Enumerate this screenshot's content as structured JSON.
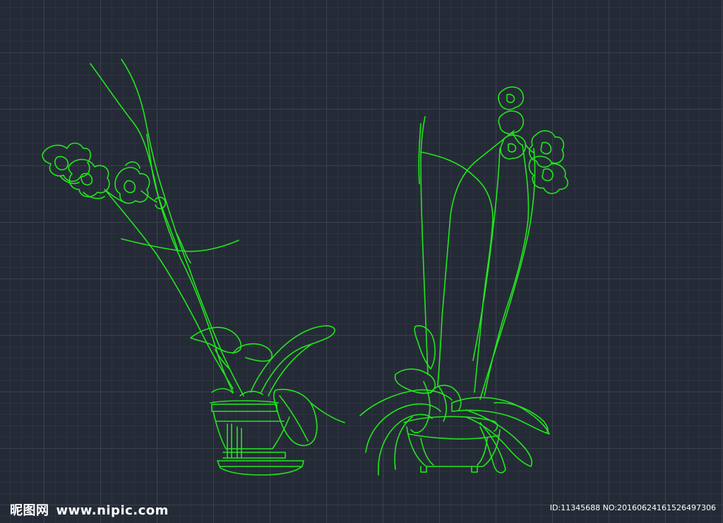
{
  "watermark": {
    "site_name": "昵图网",
    "site_url": "www.nipic.com",
    "image_id": "ID:11345688 NO:20160624161526497306"
  },
  "colors": {
    "background": "#252b36",
    "grid_major": "#3a414d",
    "grid_minor": "#2d333e",
    "linework": "#22e61e"
  },
  "drawing": {
    "subject": "two potted orchid plants in CAD elevation linework"
  }
}
